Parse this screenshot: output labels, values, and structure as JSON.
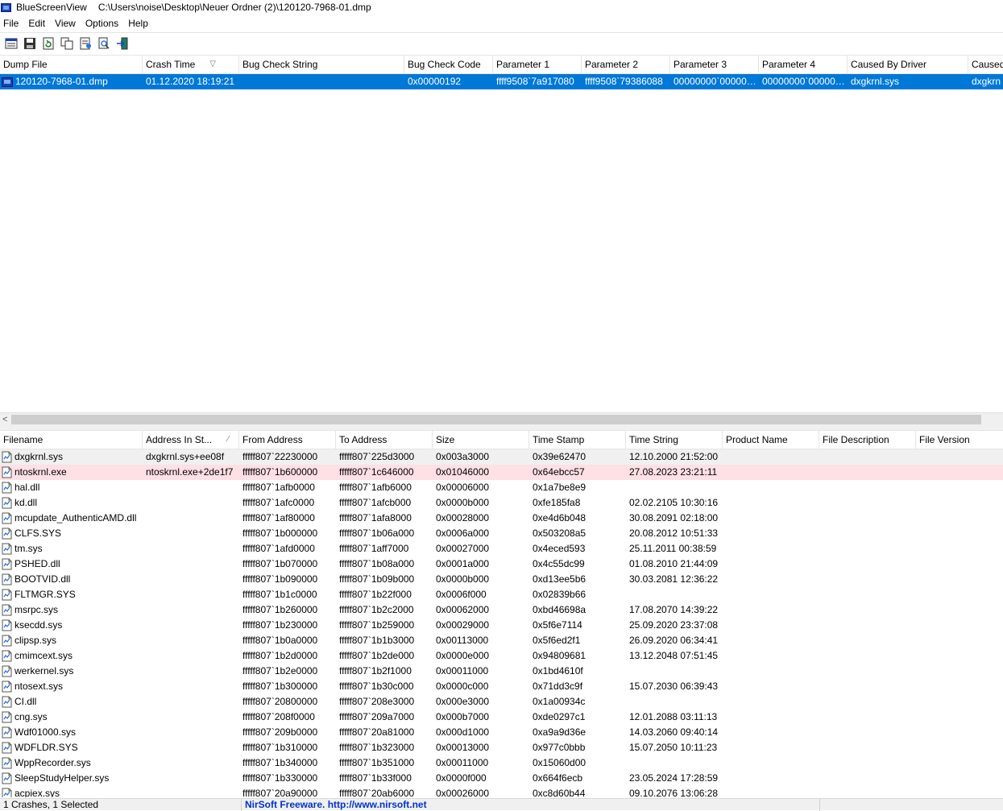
{
  "window": {
    "app_name": "BlueScreenView",
    "path": "C:\\Users\\noise\\Desktop\\Neuer Ordner (2)\\120120-7968-01.dmp"
  },
  "menu": [
    "File",
    "Edit",
    "View",
    "Options",
    "Help"
  ],
  "toolbar_icons": [
    "properties-icon",
    "save-icon",
    "refresh-icon",
    "copy-icon",
    "html-report-icon",
    "find-icon",
    "exit-icon"
  ],
  "top_grid": {
    "columns": [
      "Dump File",
      "Crash Time",
      "Bug Check String",
      "Bug Check Code",
      "Parameter 1",
      "Parameter 2",
      "Parameter 3",
      "Parameter 4",
      "Caused By Driver",
      "Caused"
    ],
    "rows": [
      [
        "120120-7968-01.dmp",
        "01.12.2020 18:19:21",
        "",
        "0x00000192",
        "ffff9508`7a917080",
        "ffff9508`79386088",
        "00000000`000000...",
        "00000000`000000...",
        "dxgkrnl.sys",
        "dxgkrn"
      ]
    ]
  },
  "bottom_grid": {
    "columns": [
      "Filename",
      "Address In St...",
      "From Address",
      "To Address",
      "Size",
      "Time Stamp",
      "Time String",
      "Product Name",
      "File Description",
      "File Version"
    ],
    "rows": [
      [
        "dxgkrnl.sys",
        "dxgkrnl.sys+ee08f",
        "fffff807`22230000",
        "fffff807`225d3000",
        "0x003a3000",
        "0x39e62470",
        "12.10.2000 21:52:00",
        "",
        "",
        ""
      ],
      [
        "ntoskrnl.exe",
        "ntoskrnl.exe+2de1f7",
        "fffff807`1b600000",
        "fffff807`1c646000",
        "0x01046000",
        "0x64ebcc57",
        "27.08.2023 23:21:11",
        "",
        "",
        ""
      ],
      [
        "hal.dll",
        "",
        "fffff807`1afb0000",
        "fffff807`1afb6000",
        "0x00006000",
        "0x1a7be8e9",
        "",
        "",
        "",
        ""
      ],
      [
        "kd.dll",
        "",
        "fffff807`1afc0000",
        "fffff807`1afcb000",
        "0x0000b000",
        "0xfe185fa8",
        "02.02.2105 10:30:16",
        "",
        "",
        ""
      ],
      [
        "mcupdate_AuthenticAMD.dll",
        "",
        "fffff807`1af80000",
        "fffff807`1afa8000",
        "0x00028000",
        "0xe4d6b048",
        "30.08.2091 02:18:00",
        "",
        "",
        ""
      ],
      [
        "CLFS.SYS",
        "",
        "fffff807`1b000000",
        "fffff807`1b06a000",
        "0x0006a000",
        "0x503208a5",
        "20.08.2012 10:51:33",
        "",
        "",
        ""
      ],
      [
        "tm.sys",
        "",
        "fffff807`1afd0000",
        "fffff807`1aff7000",
        "0x00027000",
        "0x4eced593",
        "25.11.2011 00:38:59",
        "",
        "",
        ""
      ],
      [
        "PSHED.dll",
        "",
        "fffff807`1b070000",
        "fffff807`1b08a000",
        "0x0001a000",
        "0x4c55dc99",
        "01.08.2010 21:44:09",
        "",
        "",
        ""
      ],
      [
        "BOOTVID.dll",
        "",
        "fffff807`1b090000",
        "fffff807`1b09b000",
        "0x0000b000",
        "0xd13ee5b6",
        "30.03.2081 12:36:22",
        "",
        "",
        ""
      ],
      [
        "FLTMGR.SYS",
        "",
        "fffff807`1b1c0000",
        "fffff807`1b22f000",
        "0x0006f000",
        "0x02839b66",
        "",
        "",
        "",
        ""
      ],
      [
        "msrpc.sys",
        "",
        "fffff807`1b260000",
        "fffff807`1b2c2000",
        "0x00062000",
        "0xbd46698a",
        "17.08.2070 14:39:22",
        "",
        "",
        ""
      ],
      [
        "ksecdd.sys",
        "",
        "fffff807`1b230000",
        "fffff807`1b259000",
        "0x00029000",
        "0x5f6e7114",
        "25.09.2020 23:37:08",
        "",
        "",
        ""
      ],
      [
        "clipsp.sys",
        "",
        "fffff807`1b0a0000",
        "fffff807`1b1b3000",
        "0x00113000",
        "0x5f6ed2f1",
        "26.09.2020 06:34:41",
        "",
        "",
        ""
      ],
      [
        "cmimcext.sys",
        "",
        "fffff807`1b2d0000",
        "fffff807`1b2de000",
        "0x0000e000",
        "0x94809681",
        "13.12.2048 07:51:45",
        "",
        "",
        ""
      ],
      [
        "werkernel.sys",
        "",
        "fffff807`1b2e0000",
        "fffff807`1b2f1000",
        "0x00011000",
        "0x1bd4610f",
        "",
        "",
        "",
        ""
      ],
      [
        "ntosext.sys",
        "",
        "fffff807`1b300000",
        "fffff807`1b30c000",
        "0x0000c000",
        "0x71dd3c9f",
        "15.07.2030 06:39:43",
        "",
        "",
        ""
      ],
      [
        "CI.dll",
        "",
        "fffff807`20800000",
        "fffff807`208e3000",
        "0x000e3000",
        "0x1a00934c",
        "",
        "",
        "",
        ""
      ],
      [
        "cng.sys",
        "",
        "fffff807`208f0000",
        "fffff807`209a7000",
        "0x000b7000",
        "0xde0297c1",
        "12.01.2088 03:11:13",
        "",
        "",
        ""
      ],
      [
        "Wdf01000.sys",
        "",
        "fffff807`209b0000",
        "fffff807`20a81000",
        "0x000d1000",
        "0xa9a9d36e",
        "14.03.2060 09:40:14",
        "",
        "",
        ""
      ],
      [
        "WDFLDR.SYS",
        "",
        "fffff807`1b310000",
        "fffff807`1b323000",
        "0x00013000",
        "0x977c0bbb",
        "15.07.2050 10:11:23",
        "",
        "",
        ""
      ],
      [
        "WppRecorder.sys",
        "",
        "fffff807`1b340000",
        "fffff807`1b351000",
        "0x00011000",
        "0x15060d00",
        "",
        "",
        "",
        ""
      ],
      [
        "SleepStudyHelper.sys",
        "",
        "fffff807`1b330000",
        "fffff807`1b33f000",
        "0x0000f000",
        "0x664f6ecb",
        "23.05.2024 17:28:59",
        "",
        "",
        ""
      ],
      [
        "acpiex.sys",
        "",
        "fffff807`20a90000",
        "fffff807`20ab6000",
        "0x00026000",
        "0xc8d60b44",
        "09.10.2076 13:06:28",
        "",
        "",
        ""
      ]
    ]
  },
  "status": {
    "counts": "1 Crashes, 1 Selected",
    "credit": "NirSoft Freeware.  http://www.nirsoft.net"
  },
  "colors": {
    "selection": "#0078d7",
    "highlight_pink": "#ffe0e4",
    "highlight_gray": "#f0f0f0"
  }
}
